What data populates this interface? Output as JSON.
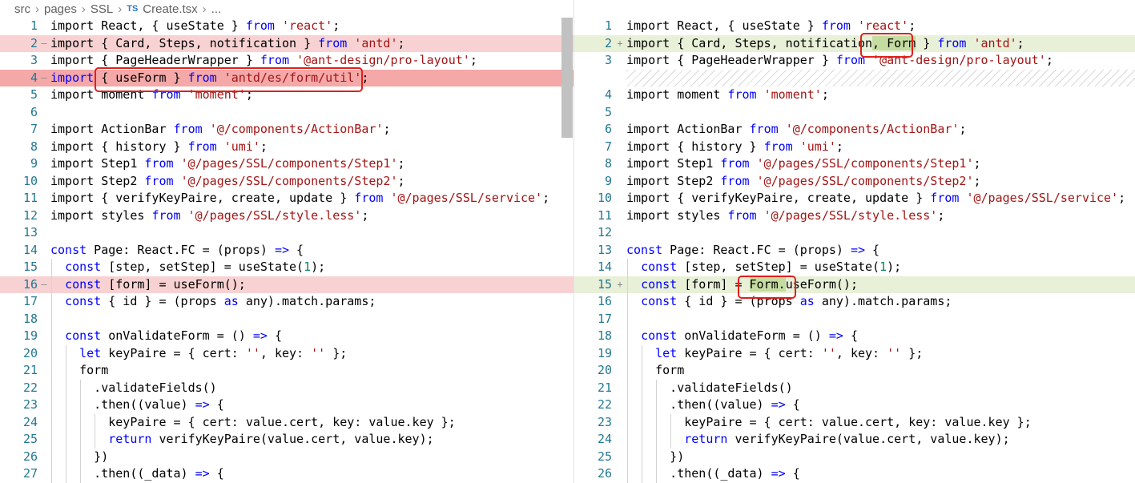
{
  "breadcrumb": {
    "parts": [
      "src",
      "pages",
      "SSL"
    ],
    "file_badge": "TS",
    "file_name": "Create.tsx",
    "ellipsis": "..."
  },
  "left_lines": [
    {
      "n": "1",
      "m": "",
      "t": "del0",
      "segs": [
        [
          "import React, { useState } ",
          "p"
        ],
        [
          "from",
          "k"
        ],
        [
          " ",
          "p"
        ],
        [
          "'react'",
          "s"
        ],
        [
          ";",
          "p"
        ]
      ]
    },
    {
      "n": "2",
      "m": "—",
      "t": "del",
      "segs": [
        [
          "import { Card, Steps, notification } ",
          "p"
        ],
        [
          "from",
          "k"
        ],
        [
          " ",
          "p"
        ],
        [
          "'antd'",
          "s"
        ],
        [
          ";",
          "p"
        ]
      ]
    },
    {
      "n": "3",
      "m": "",
      "t": "",
      "segs": [
        [
          "import { PageHeaderWrapper } ",
          "p"
        ],
        [
          "from",
          "k"
        ],
        [
          " ",
          "p"
        ],
        [
          "'@ant-design/pro-layout'",
          "s"
        ],
        [
          ";",
          "p"
        ]
      ]
    },
    {
      "n": "4",
      "m": "—",
      "t": "delstrong",
      "segs": [
        [
          "import",
          "k"
        ],
        [
          " { useForm } ",
          "p"
        ],
        [
          "from",
          "k"
        ],
        [
          " ",
          "p"
        ],
        [
          "'antd/es/form/util'",
          "s"
        ],
        [
          ";",
          "p"
        ]
      ]
    },
    {
      "n": "5",
      "m": "",
      "t": "",
      "segs": [
        [
          "import moment ",
          "p"
        ],
        [
          "from",
          "k"
        ],
        [
          " ",
          "p"
        ],
        [
          "'moment'",
          "s"
        ],
        [
          ";",
          "p"
        ]
      ]
    },
    {
      "n": "6",
      "m": "",
      "t": "",
      "segs": []
    },
    {
      "n": "7",
      "m": "",
      "t": "",
      "segs": [
        [
          "import ActionBar ",
          "p"
        ],
        [
          "from",
          "k"
        ],
        [
          " ",
          "p"
        ],
        [
          "'@/components/ActionBar'",
          "s"
        ],
        [
          ";",
          "p"
        ]
      ]
    },
    {
      "n": "8",
      "m": "",
      "t": "",
      "segs": [
        [
          "import { history } ",
          "p"
        ],
        [
          "from",
          "k"
        ],
        [
          " ",
          "p"
        ],
        [
          "'umi'",
          "s"
        ],
        [
          ";",
          "p"
        ]
      ]
    },
    {
      "n": "9",
      "m": "",
      "t": "",
      "segs": [
        [
          "import Step1 ",
          "p"
        ],
        [
          "from",
          "k"
        ],
        [
          " ",
          "p"
        ],
        [
          "'@/pages/SSL/components/Step1'",
          "s"
        ],
        [
          ";",
          "p"
        ]
      ]
    },
    {
      "n": "10",
      "m": "",
      "t": "",
      "segs": [
        [
          "import Step2 ",
          "p"
        ],
        [
          "from",
          "k"
        ],
        [
          " ",
          "p"
        ],
        [
          "'@/pages/SSL/components/Step2'",
          "s"
        ],
        [
          ";",
          "p"
        ]
      ]
    },
    {
      "n": "11",
      "m": "",
      "t": "",
      "segs": [
        [
          "import { verifyKeyPaire, create, update } ",
          "p"
        ],
        [
          "from",
          "k"
        ],
        [
          " ",
          "p"
        ],
        [
          "'@/pages/SSL/service'",
          "s"
        ],
        [
          ";",
          "p"
        ]
      ]
    },
    {
      "n": "12",
      "m": "",
      "t": "",
      "segs": [
        [
          "import styles ",
          "p"
        ],
        [
          "from",
          "k"
        ],
        [
          " ",
          "p"
        ],
        [
          "'@/pages/SSL/style.less'",
          "s"
        ],
        [
          ";",
          "p"
        ]
      ]
    },
    {
      "n": "13",
      "m": "",
      "t": "",
      "segs": []
    },
    {
      "n": "14",
      "m": "",
      "t": "",
      "segs": [
        [
          "const",
          "k"
        ],
        [
          " Page: React.FC = (props) ",
          "p"
        ],
        [
          "=>",
          "k"
        ],
        [
          " {",
          "p"
        ]
      ]
    },
    {
      "n": "15",
      "m": "",
      "t": "",
      "segs": [
        [
          "  ",
          "p"
        ],
        [
          "const",
          "k"
        ],
        [
          " [step, setStep] = useState(",
          "p"
        ],
        [
          "1",
          "n"
        ],
        [
          ");",
          "p"
        ]
      ]
    },
    {
      "n": "16",
      "m": "—",
      "t": "del",
      "segs": [
        [
          "  ",
          "p"
        ],
        [
          "const",
          "k"
        ],
        [
          " [form] = useForm();",
          "p"
        ]
      ]
    },
    {
      "n": "17",
      "m": "",
      "t": "",
      "segs": [
        [
          "  ",
          "p"
        ],
        [
          "const",
          "k"
        ],
        [
          " { id } = (props ",
          "p"
        ],
        [
          "as",
          "k"
        ],
        [
          " any).match.params;",
          "p"
        ]
      ]
    },
    {
      "n": "18",
      "m": "",
      "t": "",
      "segs": []
    },
    {
      "n": "19",
      "m": "",
      "t": "",
      "segs": [
        [
          "  ",
          "p"
        ],
        [
          "const",
          "k"
        ],
        [
          " onValidateForm = () ",
          "p"
        ],
        [
          "=>",
          "k"
        ],
        [
          " {",
          "p"
        ]
      ]
    },
    {
      "n": "20",
      "m": "",
      "t": "",
      "segs": [
        [
          "    ",
          "p"
        ],
        [
          "let",
          "k"
        ],
        [
          " keyPaire = { cert: ",
          "p"
        ],
        [
          "''",
          "s"
        ],
        [
          ", key: ",
          "p"
        ],
        [
          "''",
          "s"
        ],
        [
          " };",
          "p"
        ]
      ]
    },
    {
      "n": "21",
      "m": "",
      "t": "",
      "segs": [
        [
          "    form",
          "p"
        ]
      ]
    },
    {
      "n": "22",
      "m": "",
      "t": "",
      "segs": [
        [
          "      .validateFields()",
          "p"
        ]
      ]
    },
    {
      "n": "23",
      "m": "",
      "t": "",
      "segs": [
        [
          "      .then((value) ",
          "p"
        ],
        [
          "=>",
          "k"
        ],
        [
          " {",
          "p"
        ]
      ]
    },
    {
      "n": "24",
      "m": "",
      "t": "",
      "segs": [
        [
          "        keyPaire = { cert: value.cert, key: value.key };",
          "p"
        ]
      ]
    },
    {
      "n": "25",
      "m": "",
      "t": "",
      "segs": [
        [
          "        ",
          "p"
        ],
        [
          "return",
          "k"
        ],
        [
          " verifyKeyPaire(value.cert, value.key);",
          "p"
        ]
      ]
    },
    {
      "n": "26",
      "m": "",
      "t": "",
      "segs": [
        [
          "      })",
          "p"
        ]
      ]
    },
    {
      "n": "27",
      "m": "",
      "t": "",
      "segs": [
        [
          "      .then((_data) ",
          "p"
        ],
        [
          "=>",
          "k"
        ],
        [
          " {",
          "p"
        ]
      ]
    }
  ],
  "right_lines": [
    {
      "n": "1",
      "m": "",
      "t": "",
      "segs": [
        [
          "import React, { useState } ",
          "p"
        ],
        [
          "from",
          "k"
        ],
        [
          " ",
          "p"
        ],
        [
          "'react'",
          "s"
        ],
        [
          ";",
          "p"
        ]
      ]
    },
    {
      "n": "2",
      "m": "+",
      "t": "ins",
      "segs": [
        [
          "import { Card, Steps, notification",
          "p"
        ],
        [
          ", Form",
          "hi"
        ],
        [
          " } ",
          "p"
        ],
        [
          "from",
          "k"
        ],
        [
          " ",
          "p"
        ],
        [
          "'antd'",
          "s"
        ],
        [
          ";",
          "p"
        ]
      ]
    },
    {
      "n": "3",
      "m": "",
      "t": "",
      "segs": [
        [
          "import { PageHeaderWrapper } ",
          "p"
        ],
        [
          "from",
          "k"
        ],
        [
          " ",
          "p"
        ],
        [
          "'@ant-design/pro-layout'",
          "s"
        ],
        [
          ";",
          "p"
        ]
      ]
    },
    {
      "n": "",
      "m": "",
      "t": "hatch",
      "segs": []
    },
    {
      "n": "4",
      "m": "",
      "t": "",
      "segs": [
        [
          "import moment ",
          "p"
        ],
        [
          "from",
          "k"
        ],
        [
          " ",
          "p"
        ],
        [
          "'moment'",
          "s"
        ],
        [
          ";",
          "p"
        ]
      ]
    },
    {
      "n": "5",
      "m": "",
      "t": "",
      "segs": []
    },
    {
      "n": "6",
      "m": "",
      "t": "",
      "segs": [
        [
          "import ActionBar ",
          "p"
        ],
        [
          "from",
          "k"
        ],
        [
          " ",
          "p"
        ],
        [
          "'@/components/ActionBar'",
          "s"
        ],
        [
          ";",
          "p"
        ]
      ]
    },
    {
      "n": "7",
      "m": "",
      "t": "",
      "segs": [
        [
          "import { history } ",
          "p"
        ],
        [
          "from",
          "k"
        ],
        [
          " ",
          "p"
        ],
        [
          "'umi'",
          "s"
        ],
        [
          ";",
          "p"
        ]
      ]
    },
    {
      "n": "8",
      "m": "",
      "t": "",
      "segs": [
        [
          "import Step1 ",
          "p"
        ],
        [
          "from",
          "k"
        ],
        [
          " ",
          "p"
        ],
        [
          "'@/pages/SSL/components/Step1'",
          "s"
        ],
        [
          ";",
          "p"
        ]
      ]
    },
    {
      "n": "9",
      "m": "",
      "t": "",
      "segs": [
        [
          "import Step2 ",
          "p"
        ],
        [
          "from",
          "k"
        ],
        [
          " ",
          "p"
        ],
        [
          "'@/pages/SSL/components/Step2'",
          "s"
        ],
        [
          ";",
          "p"
        ]
      ]
    },
    {
      "n": "10",
      "m": "",
      "t": "",
      "segs": [
        [
          "import { verifyKeyPaire, create, update } ",
          "p"
        ],
        [
          "from",
          "k"
        ],
        [
          " ",
          "p"
        ],
        [
          "'@/pages/SSL/service'",
          "s"
        ],
        [
          ";",
          "p"
        ]
      ]
    },
    {
      "n": "11",
      "m": "",
      "t": "",
      "segs": [
        [
          "import styles ",
          "p"
        ],
        [
          "from",
          "k"
        ],
        [
          " ",
          "p"
        ],
        [
          "'@/pages/SSL/style.less'",
          "s"
        ],
        [
          ";",
          "p"
        ]
      ]
    },
    {
      "n": "12",
      "m": "",
      "t": "",
      "segs": []
    },
    {
      "n": "13",
      "m": "",
      "t": "",
      "segs": [
        [
          "const",
          "k"
        ],
        [
          " Page: React.FC = (props) ",
          "p"
        ],
        [
          "=>",
          "k"
        ],
        [
          " {",
          "p"
        ]
      ]
    },
    {
      "n": "14",
      "m": "",
      "t": "",
      "segs": [
        [
          "  ",
          "p"
        ],
        [
          "const",
          "k"
        ],
        [
          " [step, setStep] = useState(",
          "p"
        ],
        [
          "1",
          "n"
        ],
        [
          ");",
          "p"
        ]
      ]
    },
    {
      "n": "15",
      "m": "+",
      "t": "ins",
      "segs": [
        [
          "  ",
          "p"
        ],
        [
          "const",
          "k"
        ],
        [
          " [form] = ",
          "p"
        ],
        [
          "Form.",
          "hi"
        ],
        [
          "useForm();",
          "p"
        ]
      ]
    },
    {
      "n": "16",
      "m": "",
      "t": "",
      "segs": [
        [
          "  ",
          "p"
        ],
        [
          "const",
          "k"
        ],
        [
          " { id } = (props ",
          "p"
        ],
        [
          "as",
          "k"
        ],
        [
          " any).match.params;",
          "p"
        ]
      ]
    },
    {
      "n": "17",
      "m": "",
      "t": "",
      "segs": []
    },
    {
      "n": "18",
      "m": "",
      "t": "",
      "segs": [
        [
          "  ",
          "p"
        ],
        [
          "const",
          "k"
        ],
        [
          " onValidateForm = () ",
          "p"
        ],
        [
          "=>",
          "k"
        ],
        [
          " {",
          "p"
        ]
      ]
    },
    {
      "n": "19",
      "m": "",
      "t": "",
      "segs": [
        [
          "    ",
          "p"
        ],
        [
          "let",
          "k"
        ],
        [
          " keyPaire = { cert: ",
          "p"
        ],
        [
          "''",
          "s"
        ],
        [
          ", key: ",
          "p"
        ],
        [
          "''",
          "s"
        ],
        [
          " };",
          "p"
        ]
      ]
    },
    {
      "n": "20",
      "m": "",
      "t": "",
      "segs": [
        [
          "    form",
          "p"
        ]
      ]
    },
    {
      "n": "21",
      "m": "",
      "t": "",
      "segs": [
        [
          "      .validateFields()",
          "p"
        ]
      ]
    },
    {
      "n": "22",
      "m": "",
      "t": "",
      "segs": [
        [
          "      .then((value) ",
          "p"
        ],
        [
          "=>",
          "k"
        ],
        [
          " {",
          "p"
        ]
      ]
    },
    {
      "n": "23",
      "m": "",
      "t": "",
      "segs": [
        [
          "        keyPaire = { cert: value.cert, key: value.key };",
          "p"
        ]
      ]
    },
    {
      "n": "24",
      "m": "",
      "t": "",
      "segs": [
        [
          "        ",
          "p"
        ],
        [
          "return",
          "k"
        ],
        [
          " verifyKeyPaire(value.cert, value.key);",
          "p"
        ]
      ]
    },
    {
      "n": "25",
      "m": "",
      "t": "",
      "segs": [
        [
          "      })",
          "p"
        ]
      ]
    },
    {
      "n": "26",
      "m": "",
      "t": "",
      "segs": [
        [
          "      .then((_data) ",
          "p"
        ],
        [
          "=>",
          "k"
        ],
        [
          " {",
          "p"
        ]
      ]
    }
  ]
}
